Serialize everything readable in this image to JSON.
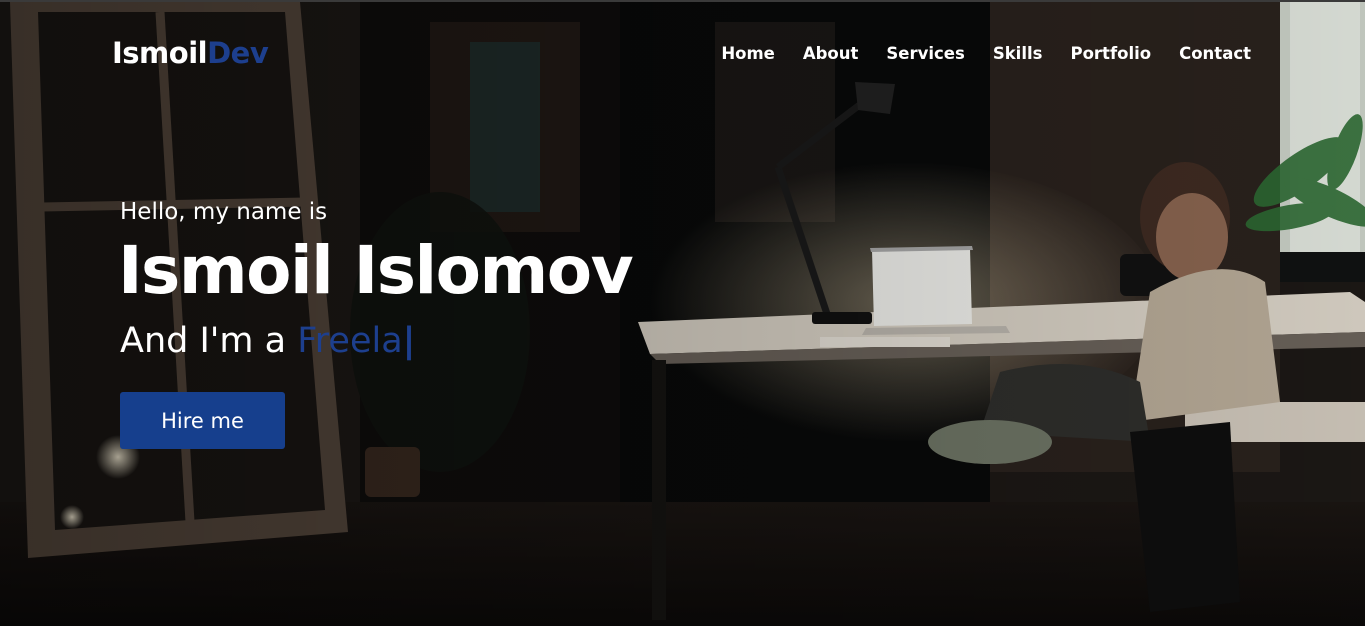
{
  "logo": {
    "main": "Ismoil",
    "accent": "Dev"
  },
  "nav": [
    "Home",
    "About",
    "Services",
    "Skills",
    "Portfolio",
    "Contact"
  ],
  "hero": {
    "greeting": "Hello, my name is",
    "name": "Ismoil Islomov",
    "role_prefix": "And I'm a ",
    "role_typed": "Freela",
    "cursor": "|",
    "cta_label": "Hire me"
  },
  "colors": {
    "accent": "#1d3f8e",
    "button": "#163f8d",
    "text": "#ffffff"
  }
}
